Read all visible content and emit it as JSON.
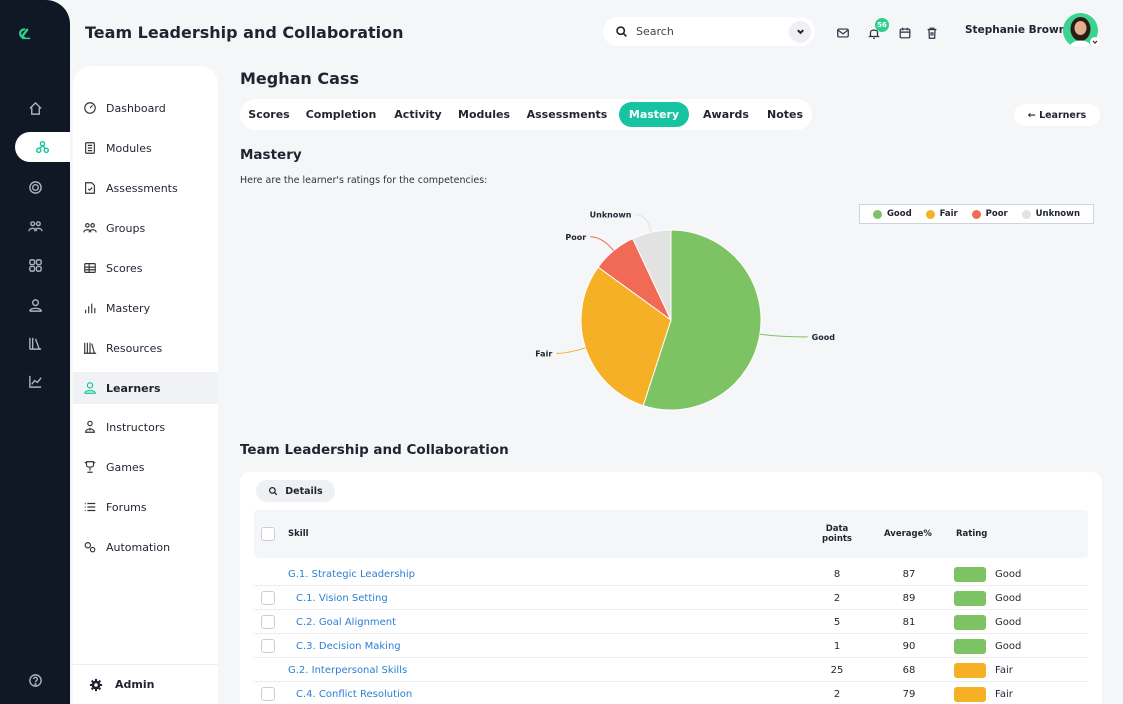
{
  "header": {
    "title": "Team Leadership and Collaboration",
    "search_placeholder": "Search",
    "notification_count": "56",
    "user_name": "Stephanie Brown"
  },
  "sidebar": {
    "items": [
      {
        "label": "Dashboard",
        "icon": "dashboard-icon"
      },
      {
        "label": "Modules",
        "icon": "modules-icon"
      },
      {
        "label": "Assessments",
        "icon": "assessments-icon"
      },
      {
        "label": "Groups",
        "icon": "groups-icon"
      },
      {
        "label": "Scores",
        "icon": "scores-icon"
      },
      {
        "label": "Mastery",
        "icon": "mastery-icon"
      },
      {
        "label": "Resources",
        "icon": "resources-icon"
      },
      {
        "label": "Learners",
        "icon": "learners-icon",
        "active": true
      },
      {
        "label": "Instructors",
        "icon": "instructors-icon"
      },
      {
        "label": "Games",
        "icon": "games-icon"
      },
      {
        "label": "Forums",
        "icon": "forums-icon"
      },
      {
        "label": "Automation",
        "icon": "automation-icon"
      }
    ],
    "admin_label": "Admin"
  },
  "learner": {
    "name": "Meghan Cass",
    "tabs": [
      "Scores",
      "Completion",
      "Activity",
      "Modules",
      "Assessments",
      "Mastery",
      "Awards",
      "Notes"
    ],
    "active_tab": "Mastery",
    "back_label": "← Learners"
  },
  "mastery": {
    "section_title": "Mastery",
    "intro": "Here are the learner's ratings for the competencies:"
  },
  "chart_data": {
    "type": "pie",
    "slices": [
      {
        "label": "Good",
        "value": 55,
        "color": "#7dc364"
      },
      {
        "label": "Fair",
        "value": 30,
        "color": "#f5b026"
      },
      {
        "label": "Poor",
        "value": 8,
        "color": "#f06a55"
      },
      {
        "label": "Unknown",
        "value": 7,
        "color": "#e2e2e2"
      }
    ],
    "legend": [
      "Good",
      "Fair",
      "Poor",
      "Unknown"
    ],
    "legend_placement": "top-right"
  },
  "table": {
    "title": "Team Leadership and Collaboration",
    "details_label": "Details",
    "columns": {
      "skill": "Skill",
      "data_points_1": "Data",
      "data_points_2": "points",
      "average": "Average%",
      "rating": "Rating"
    },
    "rows": [
      {
        "skill": "G.1. Strategic Leadership",
        "data_points": "8",
        "average": "87",
        "rating": "Good",
        "color": "#7dc364",
        "group": true
      },
      {
        "skill": "C.1. Vision Setting",
        "data_points": "2",
        "average": "89",
        "rating": "Good",
        "color": "#7dc364",
        "group": false
      },
      {
        "skill": "C.2. Goal Alignment",
        "data_points": "5",
        "average": "81",
        "rating": "Good",
        "color": "#7dc364",
        "group": false
      },
      {
        "skill": "C.3. Decision Making",
        "data_points": "1",
        "average": "90",
        "rating": "Good",
        "color": "#7dc364",
        "group": false
      },
      {
        "skill": "G.2. Interpersonal Skills",
        "data_points": "25",
        "average": "68",
        "rating": "Fair",
        "color": "#f5b026",
        "group": true
      },
      {
        "skill": "C.4. Conflict Resolution",
        "data_points": "2",
        "average": "79",
        "rating": "Fair",
        "color": "#f5b026",
        "group": false
      }
    ]
  },
  "colors": {
    "accent": "#17c3a0",
    "rail": "#101826",
    "link": "#2a7fd4"
  }
}
